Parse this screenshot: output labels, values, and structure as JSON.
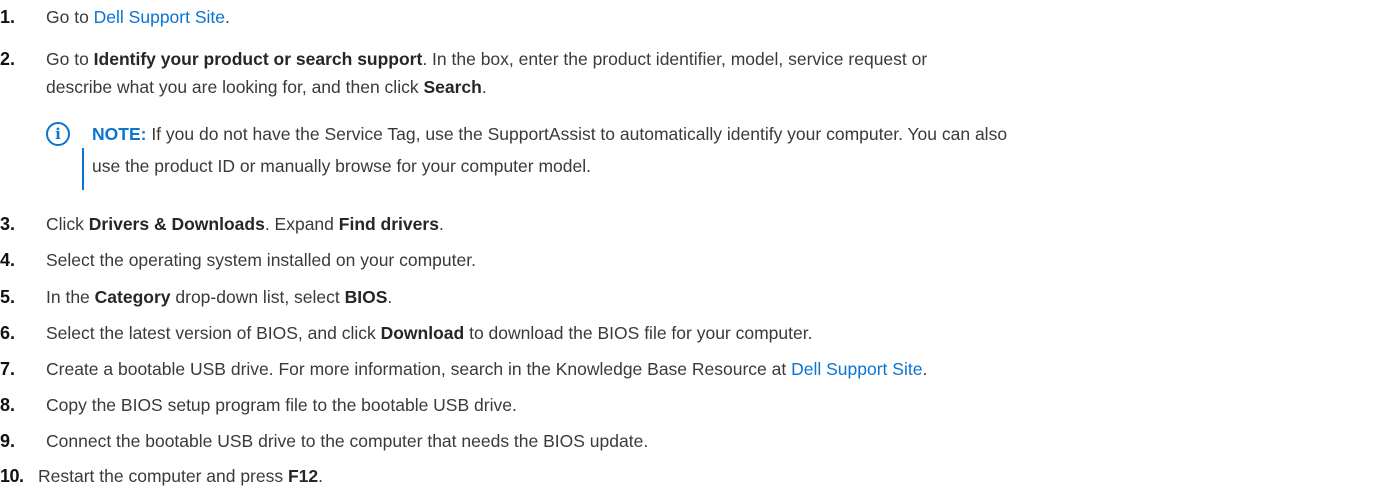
{
  "steps": [
    {
      "num": "1.",
      "parts": [
        "Go to ",
        "Dell Support Site",
        "."
      ]
    },
    {
      "num": "2.",
      "parts": [
        "Go to ",
        "Identify your product or search support",
        ". In the box, enter the product identifier, model, service request or",
        "describe what you are looking for, and then click ",
        "Search",
        "."
      ]
    },
    {
      "num": "3.",
      "parts": [
        "Click ",
        "Drivers & Downloads",
        ". Expand ",
        "Find drivers",
        "."
      ]
    },
    {
      "num": "4.",
      "parts": [
        "Select the operating system installed on your computer."
      ]
    },
    {
      "num": "5.",
      "parts": [
        "In the ",
        "Category",
        " drop-down list, select ",
        "BIOS",
        "."
      ]
    },
    {
      "num": "6.",
      "parts": [
        "Select the latest version of BIOS, and click ",
        "Download",
        " to download the BIOS file for your computer."
      ]
    },
    {
      "num": "7.",
      "parts": [
        "Create a bootable USB drive. For more information, search in the Knowledge Base Resource at ",
        "Dell Support Site",
        "."
      ]
    },
    {
      "num": "8.",
      "parts": [
        "Copy the BIOS setup program file to the bootable USB drive."
      ]
    },
    {
      "num": "9.",
      "parts": [
        "Connect the bootable USB drive to the computer that needs the BIOS update."
      ]
    },
    {
      "num": "10.",
      "parts": [
        "Restart the computer and press ",
        "F12",
        "."
      ]
    }
  ],
  "note": {
    "icon": "info-icon",
    "icon_glyph": "i",
    "label": "NOTE:",
    "line1": " If you do not have the Service Tag, use the SupportAssist to automatically identify your computer. You can also",
    "line2": "use the product ID or manually browse for your computer model."
  },
  "colors": {
    "link": "#0b74d0",
    "text": "#3a3a3a",
    "accent": "#0b74d0"
  }
}
